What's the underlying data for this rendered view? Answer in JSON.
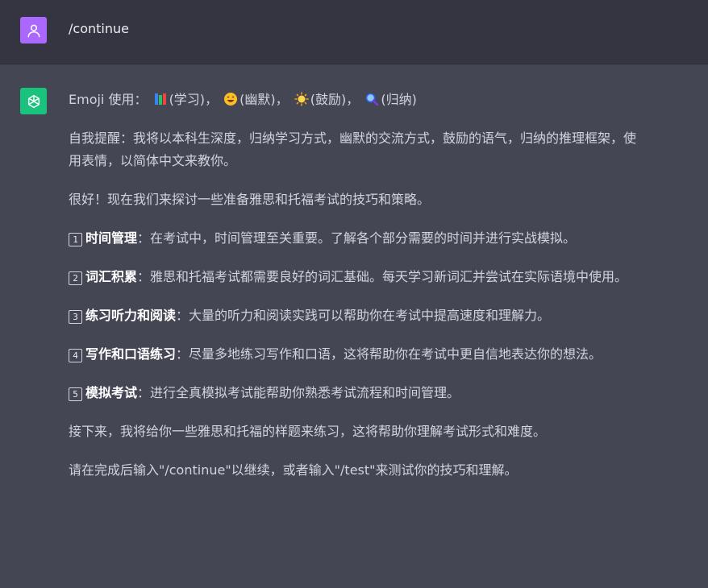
{
  "user_message": {
    "text": "/continue"
  },
  "assistant_message": {
    "emoji_line": {
      "prefix": "Emoji 使用：",
      "items": [
        {
          "icon": "books-icon",
          "label": "(学习)"
        },
        {
          "icon": "laughing-face-icon",
          "label": "(幽默)"
        },
        {
          "icon": "sun-icon",
          "label": "(鼓励)"
        },
        {
          "icon": "magnifier-icon",
          "label": "(归纳)"
        }
      ],
      "separator": "，"
    },
    "reminder": "自我提醒：我将以本科生深度，归纳学习方式，幽默的交流方式，鼓励的语气，归纳的推理框架，使用表情，以简体中文来教你。",
    "intro": "很好！现在我们来探讨一些准备雅思和托福考试的技巧和策略。",
    "tips": [
      {
        "num": "1",
        "title": "时间管理",
        "text": "：在考试中，时间管理至关重要。了解各个部分需要的时间并进行实战模拟。"
      },
      {
        "num": "2",
        "title": "词汇积累",
        "text": "：雅思和托福考试都需要良好的词汇基础。每天学习新词汇并尝试在实际语境中使用。"
      },
      {
        "num": "3",
        "title": "练习听力和阅读",
        "text": "：大量的听力和阅读实践可以帮助你在考试中提高速度和理解力。"
      },
      {
        "num": "4",
        "title": "写作和口语练习",
        "text": "：尽量多地练习写作和口语，这将帮助你在考试中更自信地表达你的想法。"
      },
      {
        "num": "5",
        "title": "模拟考试",
        "text": "：进行全真模拟考试能帮助你熟悉考试流程和时间管理。"
      }
    ],
    "next": "接下来，我将给你一些雅思和托福的样题来练习，这将帮助你理解考试形式和难度。",
    "closing": "请在完成后输入\"/continue\"以继续，或者输入\"/test\"来测试你的技巧和理解。"
  },
  "colors": {
    "user_bg": "#343541",
    "assistant_bg": "#444654",
    "user_avatar": "#ab68ff",
    "bot_avatar": "#19c37d"
  }
}
